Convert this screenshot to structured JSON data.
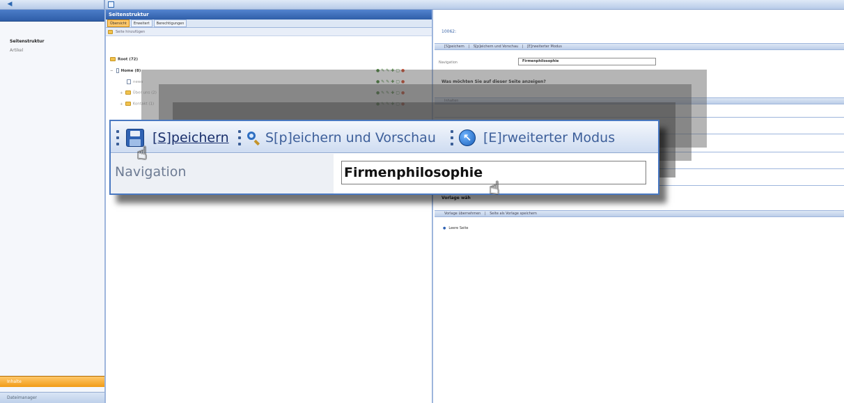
{
  "sidebar": {
    "items": [
      {
        "label": "Seitenstruktur"
      },
      {
        "label": "Artikel"
      }
    ],
    "bottom_tabs": [
      {
        "label": "Inhalte"
      },
      {
        "label": "Dateimanager"
      }
    ]
  },
  "structure_panel": {
    "title": "Seitenstruktur",
    "tabs": [
      {
        "label": "Übersicht"
      },
      {
        "label": "Erweitert"
      },
      {
        "label": "Berechtigungen"
      }
    ],
    "add_page_label": "Seite hinzufügen",
    "tree": [
      {
        "label": "Root (72)"
      },
      {
        "label": "Home (8)"
      },
      {
        "label": "news"
      },
      {
        "label": "Über uns (2)"
      },
      {
        "label": "Kontakt (1)"
      }
    ]
  },
  "page_editor": {
    "page_id": "10062:",
    "toolbar": {
      "save_label": "[S]peichern",
      "preview_label": "S[p]eichern und Vorschau",
      "extended_label": "[E]rweiterter Modus"
    },
    "navigation_label": "Navigation",
    "navigation_value": "Firmenphilosophie",
    "question": "Was möchten Sie auf dieser Seite anzeigen?",
    "section_label": "Inhalten",
    "template_label": "Vorlage wäh",
    "template_toolbar": {
      "apply_label": "Vorlage übernehmen",
      "save_as_label": "Seite als Vorlage speichern"
    },
    "template_options": [
      {
        "label": "Leere Seite"
      }
    ]
  },
  "zoom": {
    "save_label": "[S]peichern",
    "preview_label": "S[p]eichern und Vorschau",
    "extended_label": "[E]rweiterter Modus",
    "navigation_label": "Navigation",
    "navigation_value": "Firmenphilosophie"
  },
  "colors": {
    "header_blue": "#2f5ea8",
    "active_orange": "#f19b16",
    "panel_border": "#9db5dc"
  }
}
